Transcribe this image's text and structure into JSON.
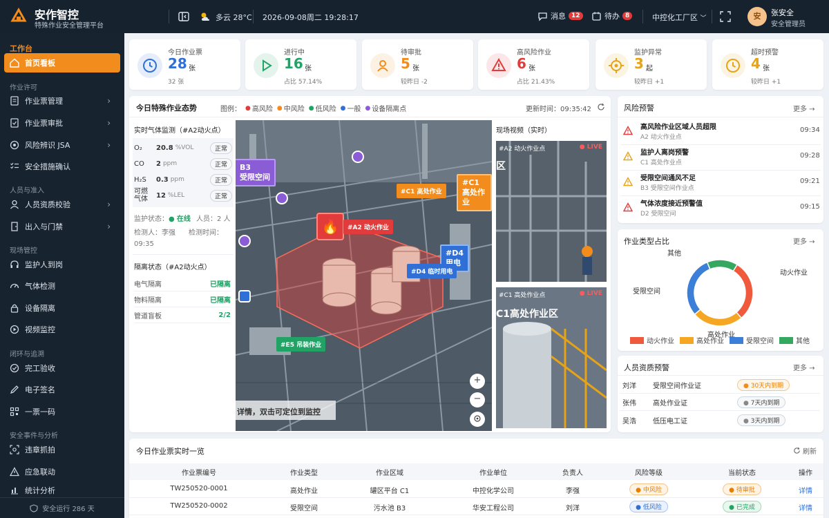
{
  "header": {
    "brand": "安作智控",
    "subtitle": "特殊作业安全管理平台",
    "weather": "多云 28°C",
    "datetime": "2026-09-08周二 19:28:17",
    "messages_label": "消息",
    "messages_count": "12",
    "todo_label": "待办",
    "todo_count": "8",
    "plant": "中控化工厂区",
    "user_avatar": "安",
    "user_name": "张安全",
    "user_role": "安全管理员"
  },
  "sidebar": {
    "workbench": "工作台",
    "home": "首页看板",
    "sections": [
      {
        "title": "作业许可",
        "items": [
          "作业票管理",
          "作业票审批",
          "风险辨识 JSA",
          "安全措施确认"
        ]
      },
      {
        "title": "人员与准入",
        "items": [
          "人员资质校验",
          "出入与门禁"
        ]
      },
      {
        "title": "现场管控",
        "items": [
          "监护人到岗",
          "气体检测",
          "设备隔离",
          "视频监控"
        ]
      },
      {
        "title": "闭环与追溯",
        "items": [
          "完工验收",
          "电子签名",
          "一票一码"
        ]
      },
      {
        "title": "安全事件与分析",
        "items": [
          "违章抓拍",
          "应急联动",
          "统计分析"
        ]
      }
    ],
    "footer": "安全运行 286 天"
  },
  "stats": [
    {
      "label": "今日作业票",
      "value": "28",
      "unit": "张",
      "sub": "32 张",
      "color": "#2f6fd6"
    },
    {
      "label": "进行中",
      "value": "16",
      "unit": "张",
      "sub": "占比 57.14%",
      "color": "#21a366"
    },
    {
      "label": "待审批",
      "value": "5",
      "unit": "张",
      "sub": "较昨日 -2",
      "color": "#f28c1c"
    },
    {
      "label": "高风险作业",
      "value": "6",
      "unit": "张",
      "sub": "占比 21.43%",
      "color": "#e23b3b"
    },
    {
      "label": "监护异常",
      "value": "3",
      "unit": "起",
      "sub": "较昨日 +1",
      "color": "#e6a317"
    },
    {
      "label": "超时预警",
      "value": "4",
      "unit": "张",
      "sub": "较昨日 +1",
      "color": "#e6a317"
    }
  ],
  "situation": {
    "title": "今日特殊作业态势",
    "legend_label": "图例：",
    "legend": [
      {
        "name": "高风险",
        "color": "#e23b3b"
      },
      {
        "name": "中风险",
        "color": "#f28c1c"
      },
      {
        "name": "低风险",
        "color": "#21a366"
      },
      {
        "name": "一般",
        "color": "#2f6fd6"
      },
      {
        "name": "设备隔离点",
        "color": "#8a5cd6"
      }
    ],
    "update_time": "更新时间：09:35:42",
    "gas_title": "实时气体监测（#A2动火点）",
    "gas": [
      {
        "name": "O₂",
        "value": "20.8",
        "unit": "%VOL",
        "status": "正常"
      },
      {
        "name": "CO",
        "value": "2",
        "unit": "ppm",
        "status": "正常"
      },
      {
        "name": "H₂S",
        "value": "0.3",
        "unit": "ppm",
        "status": "正常"
      },
      {
        "name": "可燃气体",
        "value": "12",
        "unit": "%LEL",
        "status": "正常"
      }
    ],
    "monitor_state_label": "监护状态：",
    "monitor_state": "在线",
    "personnel": "人员：2 人",
    "inspector": "检测人：李强",
    "inspect_time_label": "检测时间：",
    "inspect_time": "09:35",
    "isolation_title": "隔离状态（#A2动火点）",
    "isolation": [
      {
        "name": "电气隔离",
        "value": "已隔离"
      },
      {
        "name": "物料隔离",
        "value": "已隔离"
      },
      {
        "name": "管道盲板",
        "value": "2/2"
      }
    ],
    "map_tags": [
      {
        "text": "#C1 高处作业",
        "color": "#f28c1c"
      },
      {
        "text": "#A2 动火作业",
        "color": "#e23b3b"
      },
      {
        "text": "#D4 临时用电",
        "color": "#2f6fd6"
      },
      {
        "text": "#E5 吊装作业",
        "color": "#21a366"
      }
    ],
    "map_bg_labels": [
      "B3",
      "受限空间",
      "#C1",
      "高处作业",
      "#D4",
      "用电"
    ],
    "map_hint": "详情，双击可定位到监控",
    "video_title": "现场视频（实时）",
    "videos": [
      {
        "label": "#A2 动火作业点",
        "live": "LIVE",
        "overlay": "区"
      },
      {
        "label": "#C1 高处作业点",
        "live": "LIVE",
        "overlay": "C1高处作业区"
      }
    ]
  },
  "alerts": {
    "title": "风险预警",
    "more": "更多 →",
    "items": [
      {
        "title": "高风险作业区域人员超限",
        "sub": "A2 动火作业点",
        "time": "09:34",
        "level": "high"
      },
      {
        "title": "监护人离岗预警",
        "sub": "C1 高处作业点",
        "time": "09:28",
        "level": "mid"
      },
      {
        "title": "受限空间通风不足",
        "sub": "B3 受限空间作业点",
        "time": "09:21",
        "level": "mid"
      },
      {
        "title": "气体浓度接近预警值",
        "sub": "D2 受限空间",
        "time": "09:15",
        "level": "high"
      }
    ]
  },
  "chart_data": {
    "type": "pie",
    "title": "作业类型占比",
    "categories": [
      "动火作业",
      "高处作业",
      "受限空间",
      "其他"
    ],
    "values": [
      30,
      25,
      30,
      15
    ],
    "colors": [
      "#ef5a3c",
      "#f5a623",
      "#3b7fd9",
      "#35a860"
    ],
    "legend_position": "bottom"
  },
  "type_more": "更多 →",
  "qualification": {
    "title": "人员资质预警",
    "more": "更多 →",
    "rows": [
      {
        "name": "刘洋",
        "cert": "受限空间作业证",
        "status": "30天内到期",
        "warn": true
      },
      {
        "name": "张伟",
        "cert": "高处作业证",
        "status": "7天内到期",
        "warn": false
      },
      {
        "name": "吴浩",
        "cert": "低压电工证",
        "status": "3天内到期",
        "warn": false
      }
    ]
  },
  "tickets": {
    "title": "今日作业票实时一览",
    "refresh": "刷新",
    "columns": [
      "作业票编号",
      "作业类型",
      "作业区域",
      "作业单位",
      "负责人",
      "风险等级",
      "当前状态",
      "操作"
    ],
    "rows": [
      {
        "id": "TW250520-0001",
        "type": "高处作业",
        "area": "罐区平台 C1",
        "unit": "中控化学公司",
        "owner": "李强",
        "risk": "中风险",
        "status": "待审批",
        "action": "详情"
      },
      {
        "id": "TW250520-0002",
        "type": "受限空间",
        "area": "污水池 B3",
        "unit": "华安工程公司",
        "owner": "刘洋",
        "risk": "低风险",
        "status": "已完成",
        "action": "详情"
      }
    ]
  }
}
